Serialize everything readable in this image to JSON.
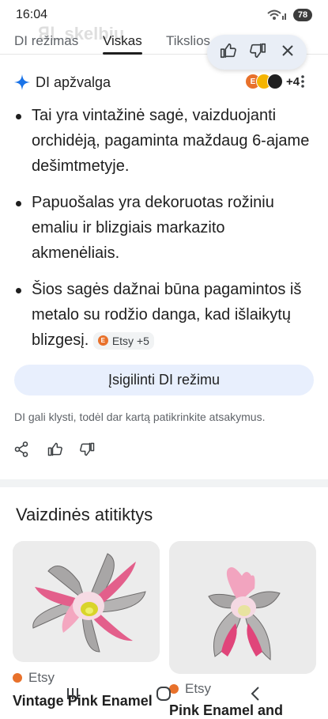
{
  "status_bar": {
    "time": "16:04",
    "battery": "78"
  },
  "tabs": [
    {
      "label": "DI režimas"
    },
    {
      "label": "Viskas",
      "active": true
    },
    {
      "label": "Tikslios"
    }
  ],
  "ai_overview": {
    "title": "DI apžvalga",
    "source_count": "+4",
    "bullets": [
      {
        "text": "Tai yra vintažinė sagė, vaizduojanti orchidėją, pagaminta maždaug 6-ajame dešimtmetyje."
      },
      {
        "text": "Papuošalas yra dekoruotas rožiniu emaliu ir blizgiais markazito akmenėliais."
      },
      {
        "text": "Šios sagės dažnai būna pagamintos iš metalo su rodžio danga, kad išlaikytų blizgesį.",
        "chip": "Etsy +5"
      }
    ],
    "upgrade_button": "Įsigilinti DI režimu",
    "disclaimer": "DI gali klysti, todėl dar kartą patikrinkite atsakymus."
  },
  "visual_matches": {
    "title": "Vaizdinės atitiktys",
    "items": [
      {
        "source": "Etsy",
        "title": "Vintage Pink Enamel"
      },
      {
        "source": "Etsy",
        "title": "Pink Enamel and"
      }
    ]
  },
  "colors": {
    "accent": "#1a73e8",
    "etsy": "#e8712b",
    "upgrade_bg": "#e8effd"
  },
  "icons": [
    "sparkle-icon",
    "thumbs-up-icon",
    "thumbs-down-icon",
    "close-icon",
    "share-icon",
    "kebab-menu-icon",
    "wifi-icon"
  ]
}
